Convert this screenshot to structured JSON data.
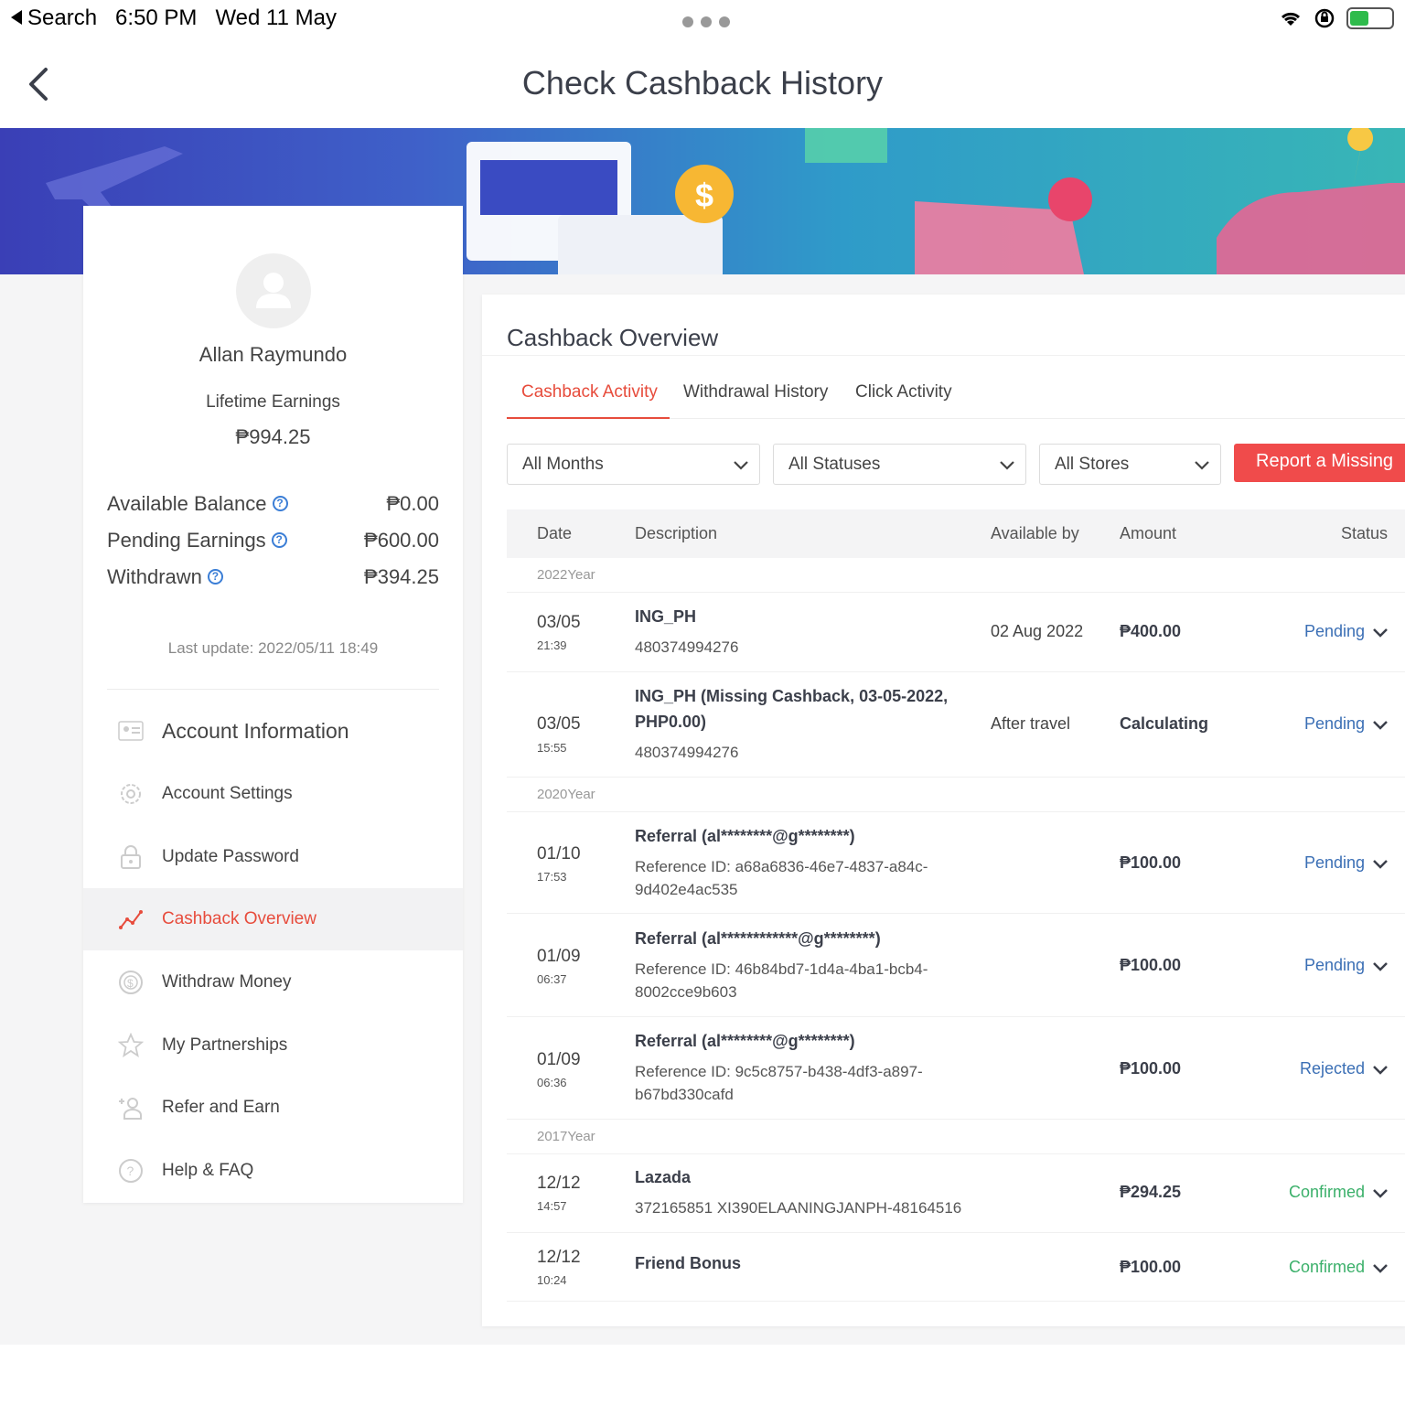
{
  "status_bar": {
    "back_app": "Search",
    "time": "6:50 PM",
    "date": "Wed 11 May"
  },
  "header": {
    "title": "Check Cashback History"
  },
  "profile": {
    "name": "Allan Raymundo",
    "lifetime_label": "Lifetime Earnings",
    "lifetime_value": "₱994.25",
    "balances": [
      {
        "label": "Available Balance",
        "value": "₱0.00"
      },
      {
        "label": "Pending Earnings",
        "value": "₱600.00"
      },
      {
        "label": "Withdrawn",
        "value": "₱394.25"
      }
    ],
    "last_update": "Last update: 2022/05/11 18:49"
  },
  "menu": [
    {
      "label": "Account Information",
      "icon": "id-card-icon"
    },
    {
      "label": "Account Settings",
      "icon": "gear-icon"
    },
    {
      "label": "Update Password",
      "icon": "lock-icon"
    },
    {
      "label": "Cashback Overview",
      "icon": "chart-line-icon"
    },
    {
      "label": "Withdraw Money",
      "icon": "coin-icon"
    },
    {
      "label": "My Partnerships",
      "icon": "star-icon"
    },
    {
      "label": "Refer and Earn",
      "icon": "add-user-icon"
    },
    {
      "label": "Help & FAQ",
      "icon": "question-icon"
    }
  ],
  "overview": {
    "title": "Cashback Overview",
    "tabs": [
      "Cashback Activity",
      "Withdrawal History",
      "Click Activity"
    ],
    "filters": [
      "All Months",
      "All Statuses",
      "All Stores"
    ],
    "report_button": "Report a Missing",
    "columns": [
      "Date",
      "Description",
      "Available by",
      "Amount",
      "Status"
    ],
    "years": [
      "2022Year",
      "2020Year",
      "2017Year"
    ],
    "rows": [
      {
        "date": "03/05",
        "time": "21:39",
        "desc": "ING_PH",
        "sub": "480374994276",
        "available": "02 Aug 2022",
        "amount": "₱400.00",
        "status": "Pending"
      },
      {
        "date": "03/05",
        "time": "15:55",
        "desc": "ING_PH (Missing Cashback, 03-05-2022, PHP0.00)",
        "sub": "480374994276",
        "available": "After travel",
        "amount": "Calculating",
        "status": "Pending"
      },
      {
        "date": "01/10",
        "time": "17:53",
        "desc": "Referral (al********@g********)",
        "sub": "Reference ID: a68a6836-46e7-4837-a84c-9d402e4ac535",
        "available": "",
        "amount": "₱100.00",
        "status": "Pending"
      },
      {
        "date": "01/09",
        "time": "06:37",
        "desc": "Referral (al************@g********)",
        "sub": "Reference ID: 46b84bd7-1d4a-4ba1-bcb4-8002cce9b603",
        "available": "",
        "amount": "₱100.00",
        "status": "Pending"
      },
      {
        "date": "01/09",
        "time": "06:36",
        "desc": "Referral (al********@g********)",
        "sub": "Reference ID: 9c5c8757-b438-4df3-a897-b67bd330cafd",
        "available": "",
        "amount": "₱100.00",
        "status": "Rejected"
      },
      {
        "date": "12/12",
        "time": "14:57",
        "desc": "Lazada",
        "sub": "372165851 XI390ELAANINGJANPH-48164516",
        "available": "",
        "amount": "₱294.25",
        "status": "Confirmed"
      },
      {
        "date": "12/12",
        "time": "10:24",
        "desc": "Friend Bonus",
        "sub": "",
        "available": "",
        "amount": "₱100.00",
        "status": "Confirmed"
      }
    ]
  },
  "colors": {
    "accent": "#e74c3c",
    "pending": "#3b6fb5",
    "confirmed": "#3bb06a",
    "report": "#f04b4b"
  }
}
